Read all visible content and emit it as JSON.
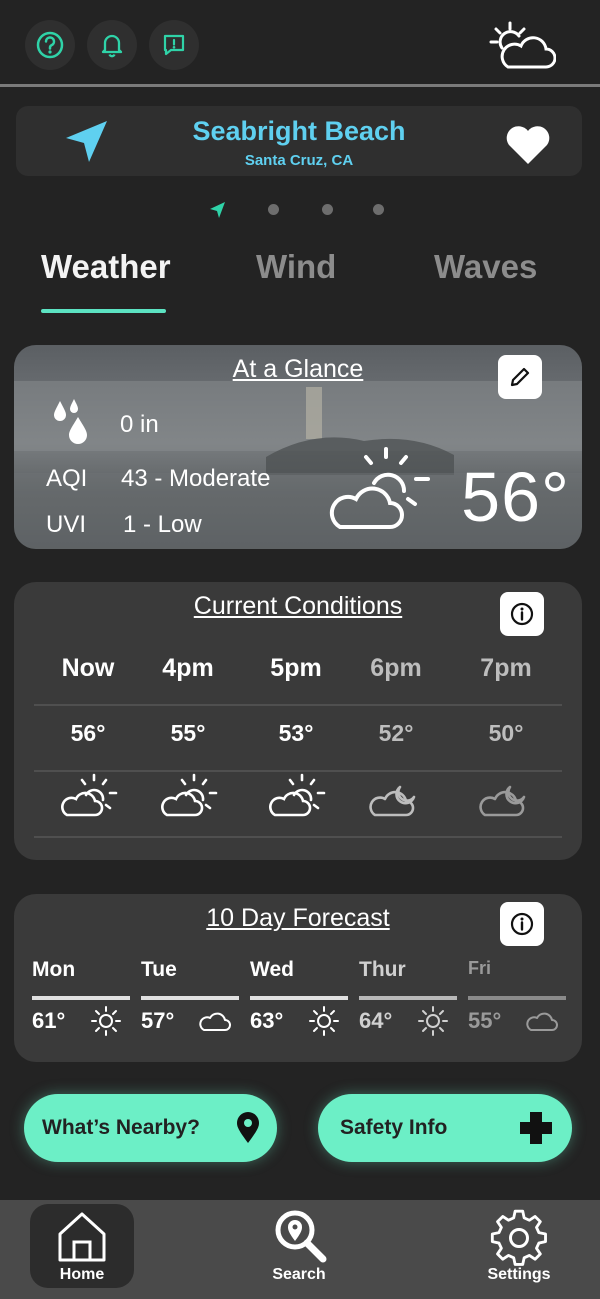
{
  "header": {
    "help_icon": "question-icon",
    "alerts_icon": "bell-icon",
    "feedback_icon": "message-alert-icon",
    "weather_icon": "partly-cloudy-icon"
  },
  "location": {
    "name": "Seabright Beach",
    "sub": "Santa Cruz, CA",
    "accent": "#5fd0f0"
  },
  "tabs": [
    {
      "label": "Weather",
      "active": true
    },
    {
      "label": "Wind",
      "active": false
    },
    {
      "label": "Waves",
      "active": false
    }
  ],
  "glance": {
    "title": "At a Glance",
    "rain_value": "0 in",
    "aqi_label": "AQI",
    "aqi_value": "43 - Moderate",
    "uvi_label": "UVI",
    "uvi_value": "1 - Low",
    "temp": "56°"
  },
  "current": {
    "title": "Current Conditions",
    "hours": [
      {
        "label": "Now",
        "temp": "56°",
        "icon": "partly-cloudy-icon",
        "dim": false
      },
      {
        "label": "4pm",
        "temp": "55°",
        "icon": "partly-cloudy-icon",
        "dim": false
      },
      {
        "label": "5pm",
        "temp": "53°",
        "icon": "partly-cloudy-icon",
        "dim": false
      },
      {
        "label": "6pm",
        "temp": "52°",
        "icon": "cloudy-night-icon",
        "dim": true
      },
      {
        "label": "7pm",
        "temp": "50°",
        "icon": "cloudy-night-icon",
        "dim": true
      }
    ]
  },
  "forecast": {
    "title": "10 Day Forecast",
    "days": [
      {
        "day": "Mon",
        "temp": "61°",
        "icon": "sun-icon",
        "dim": false
      },
      {
        "day": "Tue",
        "temp": "57°",
        "icon": "cloud-icon",
        "dim": false
      },
      {
        "day": "Wed",
        "temp": "63°",
        "icon": "sun-icon",
        "dim": false
      },
      {
        "day": "Thur",
        "temp": "64°",
        "icon": "sun-icon",
        "dim": true
      },
      {
        "day": "Fri",
        "temp": "55°",
        "icon": "cloud-icon",
        "dim": true
      }
    ]
  },
  "actions": {
    "nearby": "What’s Nearby?",
    "safety": "Safety Info"
  },
  "nav": {
    "home": "Home",
    "search": "Search",
    "settings": "Settings"
  },
  "colors": {
    "accent_green": "#5ce3c2",
    "button_green": "#6cefc6",
    "background": "#232323",
    "card": "#3a3a3a"
  }
}
